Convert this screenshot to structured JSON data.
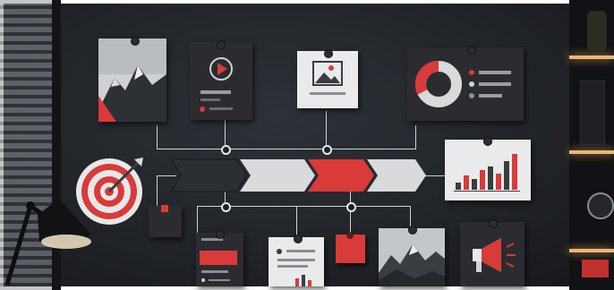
{
  "scene": "wall-board",
  "colors": {
    "accent": "#d93a3a",
    "card_dark": "#2a2c30",
    "card_light": "#e9eaeb",
    "wall": "#23262b"
  },
  "icons": [
    "play-icon",
    "image-icon",
    "donut-chart-icon",
    "bar-chart-icon",
    "target-icon",
    "megaphone-icon",
    "desk-lamp-icon",
    "mountain-photo"
  ],
  "chevrons": [
    {
      "color": "#2b2e33"
    },
    {
      "color": "#d9dadc"
    },
    {
      "color": "#d93a3a"
    },
    {
      "color": "#d9dadc"
    }
  ]
}
